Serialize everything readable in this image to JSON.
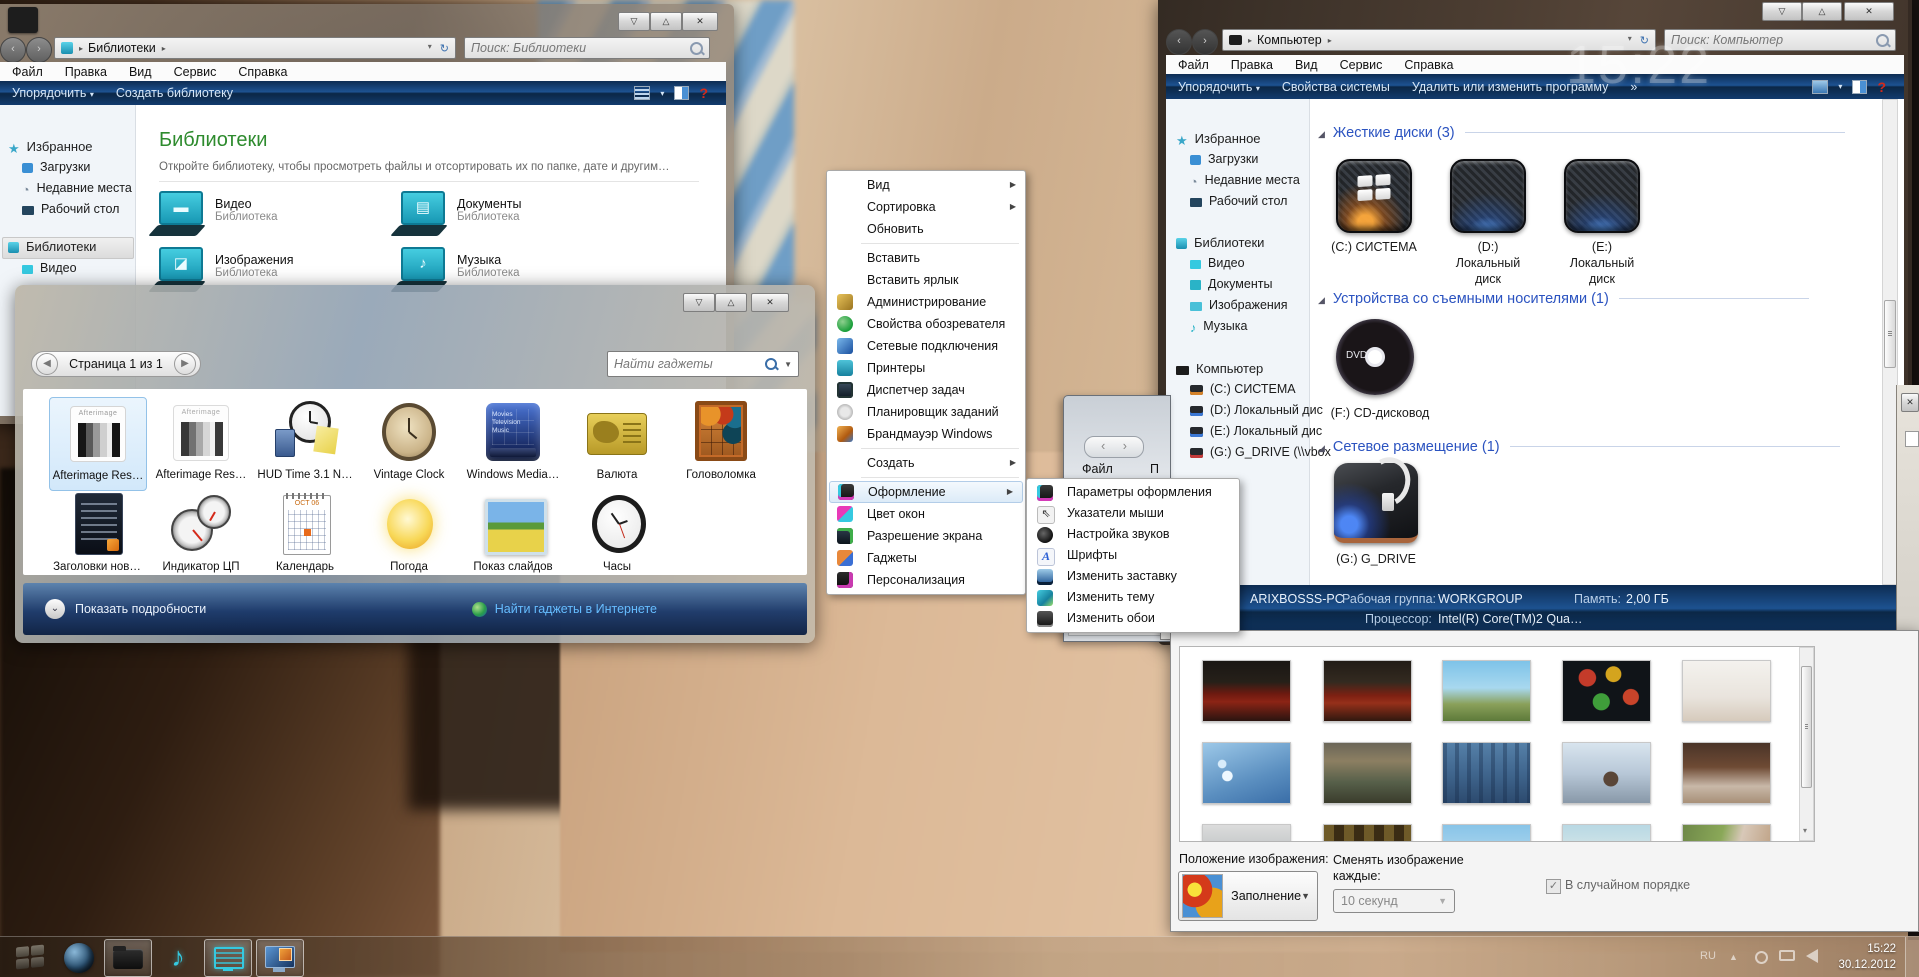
{
  "desktop": {
    "big_clock": "15:22"
  },
  "window_controls": {
    "minimize": "▽",
    "maximize": "△",
    "close": "✕"
  },
  "libraries_window": {
    "address": "Библиотеки",
    "search_placeholder": "Поиск: Библиотеки",
    "menu": [
      "Файл",
      "Правка",
      "Вид",
      "Сервис",
      "Справка"
    ],
    "toolbar": {
      "organize": "Упорядочить",
      "new_library": "Создать библиотеку",
      "help_icon": "?"
    },
    "sidebar": {
      "favorites_label": "Избранное",
      "favorites": [
        "Загрузки",
        "Недавние места",
        "Рабочий стол"
      ],
      "libraries_label": "Библиотеки",
      "libraries": [
        "Видео"
      ]
    },
    "main": {
      "title": "Библиотеки",
      "subtitle": "Откройте библиотеку, чтобы просмотреть файлы и отсортировать их по папке, дате и другим…",
      "items": [
        {
          "name": "Видео",
          "type": "Библиотека"
        },
        {
          "name": "Документы",
          "type": "Библиотека"
        },
        {
          "name": "Изображения",
          "type": "Библиотека"
        },
        {
          "name": "Музыка",
          "type": "Библиотека"
        }
      ]
    }
  },
  "gadgets_window": {
    "page_label": "Страница 1 из 1",
    "search_placeholder": "Найти гаджеты",
    "row1": [
      "Afterimage Res…",
      "Afterimage Res…",
      "HUD Time 3.1 N…",
      "Vintage Clock",
      "Windows Media…",
      "Валюта",
      "Головоломка"
    ],
    "row2": [
      "Заголовки нов…",
      "Индикатор ЦП",
      "Календарь",
      "Погода",
      "Показ слайдов",
      "Часы"
    ],
    "show_details": "Показать подробности",
    "online_link": "Найти гаджеты в Интернете"
  },
  "context_menu": {
    "items": [
      {
        "label": "Вид"
      },
      {
        "label": "Сортировка"
      },
      {
        "label": "Обновить"
      },
      {
        "label": "Вставить"
      },
      {
        "label": "Вставить ярлык"
      },
      {
        "label": "Администрирование"
      },
      {
        "label": "Свойства обозревателя"
      },
      {
        "label": "Сетевые подключения"
      },
      {
        "label": "Принтеры"
      },
      {
        "label": "Диспетчер задач"
      },
      {
        "label": "Планировщик заданий"
      },
      {
        "label": "Брандмауэр Windows"
      },
      {
        "label": "Создать"
      },
      {
        "label": "Оформление"
      },
      {
        "label": "Цвет окон"
      },
      {
        "label": "Разрешение экрана"
      },
      {
        "label": "Гаджеты"
      },
      {
        "label": "Персонализация"
      }
    ]
  },
  "appearance_submenu": {
    "items": [
      {
        "label": "Параметры оформления"
      },
      {
        "label": "Указатели мыши"
      },
      {
        "label": "Настройка звуков"
      },
      {
        "label": "Шрифты"
      },
      {
        "label": "Изменить заставку"
      },
      {
        "label": "Изменить тему"
      },
      {
        "label": "Изменить обои"
      }
    ]
  },
  "fragment_window": {
    "back": "‹",
    "forward": "›",
    "menu_file": "Файл",
    "menu_second": "П"
  },
  "computer_window": {
    "address": "Компьютер",
    "search_placeholder": "Поиск: Компьютер",
    "menu": [
      "Файл",
      "Правка",
      "Вид",
      "Сервис",
      "Справка"
    ],
    "toolbar": {
      "organize": "Упорядочить",
      "system_properties": "Свойства системы",
      "uninstall": "Удалить или изменить программу",
      "more": "»",
      "help_icon": "?"
    },
    "sidebar": {
      "favorites_label": "Избранное",
      "favorites": [
        "Загрузки",
        "Недавние места",
        "Рабочий стол"
      ],
      "libraries_label": "Библиотеки",
      "libraries": [
        "Видео",
        "Документы",
        "Изображения",
        "Музыка"
      ],
      "computer_label": "Компьютер",
      "drives": [
        "(C:) СИСТЕМА",
        "(D:) Локальный дис",
        "(E:) Локальный дис",
        "(G:) G_DRIVE (\\\\vbox"
      ]
    },
    "sections": {
      "hard_disks": {
        "title": "Жесткие диски (3)",
        "items": [
          {
            "label": "(C:) СИСТЕМА"
          },
          {
            "label": "(D:) Локальный диск"
          },
          {
            "label": "(E:) Локальный диск"
          }
        ]
      },
      "removable": {
        "title": "Устройства со съемными носителями (1)",
        "dvd_text": "DVD",
        "f_label": "(F:) CD-дисковод"
      },
      "network": {
        "title": "Сетевое размещение (1)",
        "g_label": "(G:) G_DRIVE"
      }
    },
    "status": {
      "computer_name": "ARIXBOSSS-PC",
      "workgroup_label": "Рабочая группа:",
      "workgroup": "WORKGROUP",
      "memory_label": "Память:",
      "memory": "2,00 ГБ",
      "processor_label": "Процессор:",
      "processor": "Intel(R) Core(TM)2 Qua…"
    }
  },
  "wallpaper_window": {
    "position_label": "Положение изображения:",
    "position_value": "Заполнение",
    "interval_label_line1": "Сменять изображение",
    "interval_label_line2": "каждые:",
    "interval_value": "10 секунд",
    "shuffle_label": "В случайном порядке",
    "thumbnails": [
      {
        "name": "red-car-garage-1",
        "style": "background:linear-gradient(180deg,#1a1714 0%,#262019 35%,#6e1a10 55%,#8c2415 68%,#2a1410 100%)"
      },
      {
        "name": "red-car-garage-2",
        "style": "background:linear-gradient(180deg,#221c16 0%,#332a20 35%,#7e2012 58%,#96301a 70%,#30180f 100%)"
      },
      {
        "name": "landscape-planes",
        "style": "background:linear-gradient(180deg,#7ec3e8 0%,#a8d8ef 45%,#8aa05a 72%,#5d7a3a 100%)"
      },
      {
        "name": "new-year-2013",
        "style": "background:radial-gradient(circle at 28% 28%,#c43b2a 0 11%,transparent 12%),radial-gradient(circle at 58% 22%,#d4a41e 0 11%,transparent 12%),radial-gradient(circle at 44% 68%,#3f9e3a 0 13%,transparent 14%),radial-gradient(circle at 78% 60%,#c9442a 0 10%,transparent 11%),#101418"
      },
      {
        "name": "studio-model",
        "style": "background:linear-gradient(180deg,#f4f2ee 0%,#e9e4dd 60%,#d6cabc 100%)"
      },
      {
        "name": "blue-christmas-tree",
        "style": "background:radial-gradient(circle at 28% 55%,#eef8ff 0 7%,transparent 8%),radial-gradient(circle at 22% 35%,#d8ecfa 0 5%,transparent 6%),linear-gradient(160deg,#9cc8e8 0%,#5b8fc0 60%,#3a6ea8 100%)"
      },
      {
        "name": "abandoned-room",
        "style": "background:linear-gradient(180deg,#6b6658 0%,#8c7f62 30%,#57604a 65%,#3a3c2c 100%)"
      },
      {
        "name": "winter-forest",
        "style": "background:repeating-linear-gradient(90deg,rgba(20,40,70,.35) 0 4px,transparent 4px 12px),linear-gradient(180deg,#5580a8 0%,#40668e 50%,#2c4a6e 100%)"
      },
      {
        "name": "snow-scene",
        "style": "background:radial-gradient(circle at 55% 60%,#5a4638 0 12%,transparent 13%),linear-gradient(180deg,#d8e4ee 0%,#b8c8d8 50%,#8898a8 100%)"
      },
      {
        "name": "hotel-room",
        "style": "background:linear-gradient(180deg,#4a3428 0%,#6e4a34 40%,#c8b8a8 72%,#a89078 100%)"
      },
      {
        "name": "winter-trees",
        "style": "background:linear-gradient(180deg,#dcdcdc 0%,#b8bcbe 60%,#989ca0 100%)"
      },
      {
        "name": "bottles",
        "style": "background:repeating-linear-gradient(90deg,#6e5a28 0 10px,#3a2c14 10px 20px),linear-gradient(180deg,#2a2012,#3a2c14)"
      },
      {
        "name": "beach-person",
        "style": "background:linear-gradient(180deg,#88c4e8 0%,#b0d8ee 55%,#c8a878 80%,#b08858 100%)"
      },
      {
        "name": "pale-beach",
        "style": "background:linear-gradient(180deg,#b8d8e4 0%,#d8e8e8 50%,#d8cba8 100%)"
      },
      {
        "name": "legs-green",
        "style": "background:linear-gradient(105deg,#6e8848 0%,#8aa858 40%,#d8c8b8 60%,#b89878 100%)"
      }
    ]
  },
  "taskbar": {
    "lang": "RU",
    "time": "15:22",
    "date": "30.12.2012"
  }
}
